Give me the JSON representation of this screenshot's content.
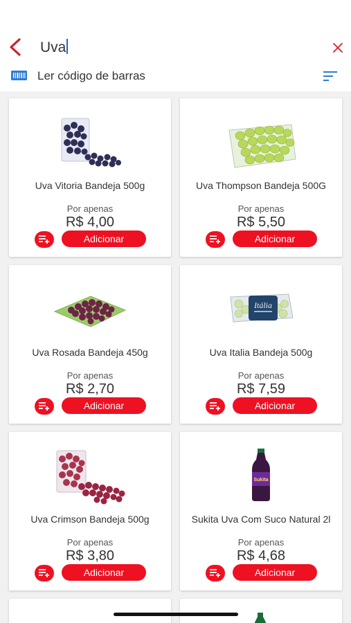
{
  "search": {
    "query": "Uva"
  },
  "barcode": {
    "label": "Ler código de barras"
  },
  "colors": {
    "accent": "#ee1122",
    "link": "#1a6bd8"
  },
  "icons": {
    "back": "chevron-left-icon",
    "clear": "close-icon",
    "barcode": "barcode-icon",
    "filter": "sort-icon",
    "add_to_list": "playlist-add-icon"
  },
  "products": [
    {
      "name": "Uva Vitoria Bandeja 500g",
      "price_label": "Por apenas",
      "price": "R$ 4,00",
      "button": "Adicionar"
    },
    {
      "name": "Uva Thompson Bandeja 500G",
      "price_label": "Por apenas",
      "price": "R$ 5,50",
      "button": "Adicionar"
    },
    {
      "name": "Uva Rosada Bandeja 450g",
      "price_label": "Por apenas",
      "price": "R$ 2,70",
      "button": "Adicionar"
    },
    {
      "name": "Uva Italia Bandeja 500g",
      "price_label": "Por apenas",
      "price": "R$ 7,59",
      "button": "Adicionar"
    },
    {
      "name": "Uva Crimson Bandeja 500g",
      "price_label": "Por apenas",
      "price": "R$ 3,80",
      "button": "Adicionar"
    },
    {
      "name": "Sukita Uva Com Suco Natural 2l",
      "price_label": "Por apenas",
      "price": "R$ 4,68",
      "button": "Adicionar"
    }
  ]
}
